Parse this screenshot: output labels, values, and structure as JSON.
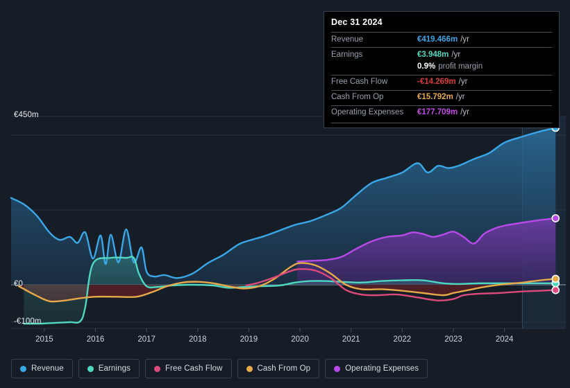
{
  "colors": {
    "background": "#171d27",
    "revenue": "#3aa7e8",
    "earnings": "#4fd8c0",
    "free_cash_flow": "#de4a7b",
    "cash_from_op": "#e8a94a",
    "operating_expenses": "#b84ae8",
    "gridline": "#2b3340",
    "zero_line": "#8e949e",
    "negative_fill": "#4e1f26"
  },
  "tooltip": {
    "date": "Dec 31 2024",
    "rows": [
      {
        "key": "Revenue",
        "value": "€419.466m",
        "unit": "/yr",
        "color": "#3aa7e8"
      },
      {
        "key": "Earnings",
        "value": "€3.948m",
        "unit": "/yr",
        "color": "#4fd8c0"
      },
      {
        "key": "",
        "value": "0.9%",
        "sub": "profit margin",
        "color": "#ffffff"
      },
      {
        "key": "Free Cash Flow",
        "value": "-€14.269m",
        "unit": "/yr",
        "color": "#e03b3b"
      },
      {
        "key": "Cash From Op",
        "value": "€15.792m",
        "unit": "/yr",
        "color": "#e8a94a"
      },
      {
        "key": "Operating Expenses",
        "value": "€177.709m",
        "unit": "/yr",
        "color": "#c24ae8"
      }
    ]
  },
  "legend": {
    "items": [
      {
        "label": "Revenue",
        "color": "#3aa7e8"
      },
      {
        "label": "Earnings",
        "color": "#4fd8c0"
      },
      {
        "label": "Free Cash Flow",
        "color": "#de4a7b"
      },
      {
        "label": "Cash From Op",
        "color": "#e8a94a"
      },
      {
        "label": "Operating Expenses",
        "color": "#b84ae8"
      }
    ]
  },
  "chart_data": {
    "type": "area",
    "title": "",
    "xlabel": "",
    "ylabel": "",
    "currency": "EUR",
    "units": "millions",
    "grid": true,
    "legend_position": "bottom",
    "y_axis": {
      "labels": [
        "€450m",
        "€0",
        "-€100m"
      ],
      "values": [
        450,
        0,
        -100
      ],
      "ylim": [
        -130,
        470
      ],
      "gridlines": [
        450,
        400,
        200,
        0,
        -100
      ]
    },
    "x_axis": {
      "tick_labels": [
        "2015",
        "2016",
        "2017",
        "2018",
        "2019",
        "2020",
        "2021",
        "2022",
        "2023",
        "2024"
      ],
      "tick_values": [
        2015,
        2016,
        2017,
        2018,
        2019,
        2020,
        2021,
        2022,
        2023,
        2024
      ],
      "xlim": [
        2014.35,
        2025.2
      ],
      "forecast_start": 2024.35
    },
    "series": [
      {
        "name": "Revenue",
        "color": "#3aa7e8",
        "x": [
          2014.35,
          2014.6,
          2014.85,
          2015.1,
          2015.3,
          2015.5,
          2015.65,
          2015.8,
          2015.95,
          2016.1,
          2016.2,
          2016.3,
          2016.45,
          2016.6,
          2016.75,
          2016.9,
          2017.0,
          2017.15,
          2017.35,
          2017.6,
          2017.9,
          2018.2,
          2018.5,
          2018.8,
          2019.0,
          2019.3,
          2019.6,
          2019.9,
          2020.2,
          2020.5,
          2020.8,
          2021.1,
          2021.4,
          2021.7,
          2022.0,
          2022.3,
          2022.5,
          2022.7,
          2022.9,
          2023.1,
          2023.4,
          2023.7,
          2024.0,
          2024.35,
          2024.7,
          2025.0
        ],
        "y": [
          232,
          215,
          185,
          140,
          120,
          128,
          112,
          140,
          70,
          132,
          55,
          134,
          60,
          148,
          60,
          100,
          35,
          22,
          26,
          18,
          30,
          58,
          80,
          108,
          118,
          130,
          145,
          160,
          170,
          186,
          205,
          240,
          272,
          286,
          300,
          325,
          300,
          318,
          312,
          318,
          336,
          352,
          380,
          396,
          410,
          419.466
        ],
        "end_value": 419.466
      },
      {
        "name": "Earnings",
        "color": "#4fd8c0",
        "x": [
          2014.6,
          2014.9,
          2015.2,
          2015.5,
          2015.7,
          2015.8,
          2015.95,
          2016.3,
          2016.6,
          2016.75,
          2016.85,
          2017.0,
          2017.2,
          2017.5,
          2017.9,
          2018.3,
          2018.6,
          2018.9,
          2019.2,
          2019.6,
          2019.9,
          2020.2,
          2020.5,
          2020.8,
          2021.2,
          2021.6,
          2022.0,
          2022.4,
          2022.8,
          2023.1,
          2023.5,
          2023.9,
          2024.35,
          2024.7,
          2025.0
        ],
        "y": [
          -104,
          -104,
          -102,
          -100,
          -98,
          -60,
          56,
          72,
          72,
          72,
          30,
          -4,
          -6,
          -2,
          0,
          -2,
          -8,
          -6,
          -4,
          -2,
          6,
          10,
          10,
          8,
          6,
          10,
          12,
          12,
          4,
          2,
          4,
          4,
          4,
          4,
          3.948
        ],
        "end_value": 3.948
      },
      {
        "name": "Free Cash Flow",
        "color": "#de4a7b",
        "x": [
          2018.95,
          2019.2,
          2019.5,
          2019.8,
          2020.0,
          2020.3,
          2020.6,
          2020.9,
          2021.2,
          2021.5,
          2021.9,
          2022.3,
          2022.7,
          2023.0,
          2023.2,
          2023.5,
          2023.9,
          2024.35,
          2024.7,
          2025.0
        ],
        "y": [
          -2,
          6,
          20,
          36,
          42,
          38,
          18,
          -14,
          -26,
          -28,
          -26,
          -34,
          -42,
          -38,
          -28,
          -24,
          -22,
          -18,
          -16,
          -14.269
        ],
        "end_value": -14.269
      },
      {
        "name": "Cash From Op",
        "color": "#e8a94a",
        "x": [
          2014.5,
          2014.8,
          2015.1,
          2015.4,
          2015.7,
          2016.0,
          2016.4,
          2016.8,
          2017.1,
          2017.4,
          2017.7,
          2018.0,
          2018.3,
          2018.6,
          2018.9,
          2019.2,
          2019.5,
          2019.8,
          2020.0,
          2020.3,
          2020.6,
          2020.9,
          2021.2,
          2021.6,
          2022.0,
          2022.4,
          2022.8,
          2023.0,
          2023.3,
          2023.6,
          2023.9,
          2024.35,
          2024.7,
          2025.0
        ],
        "y": [
          -4,
          -26,
          -44,
          -42,
          -36,
          -32,
          -32,
          -32,
          -20,
          -4,
          6,
          8,
          4,
          -4,
          -10,
          -4,
          16,
          46,
          58,
          52,
          30,
          0,
          -12,
          -12,
          -16,
          -22,
          -28,
          -22,
          -14,
          -6,
          0,
          6,
          12,
          15.792
        ],
        "end_value": 15.792
      },
      {
        "name": "Operating Expenses",
        "color": "#b84ae8",
        "x": [
          2019.95,
          2020.2,
          2020.5,
          2020.8,
          2021.1,
          2021.4,
          2021.7,
          2022.0,
          2022.2,
          2022.4,
          2022.6,
          2022.8,
          2023.0,
          2023.2,
          2023.4,
          2023.6,
          2023.8,
          2024.0,
          2024.35,
          2024.7,
          2025.0
        ],
        "y": [
          62,
          64,
          66,
          74,
          96,
          116,
          128,
          132,
          140,
          136,
          128,
          134,
          142,
          128,
          110,
          136,
          150,
          158,
          166,
          173,
          177.709
        ],
        "end_value": 177.709
      }
    ]
  }
}
